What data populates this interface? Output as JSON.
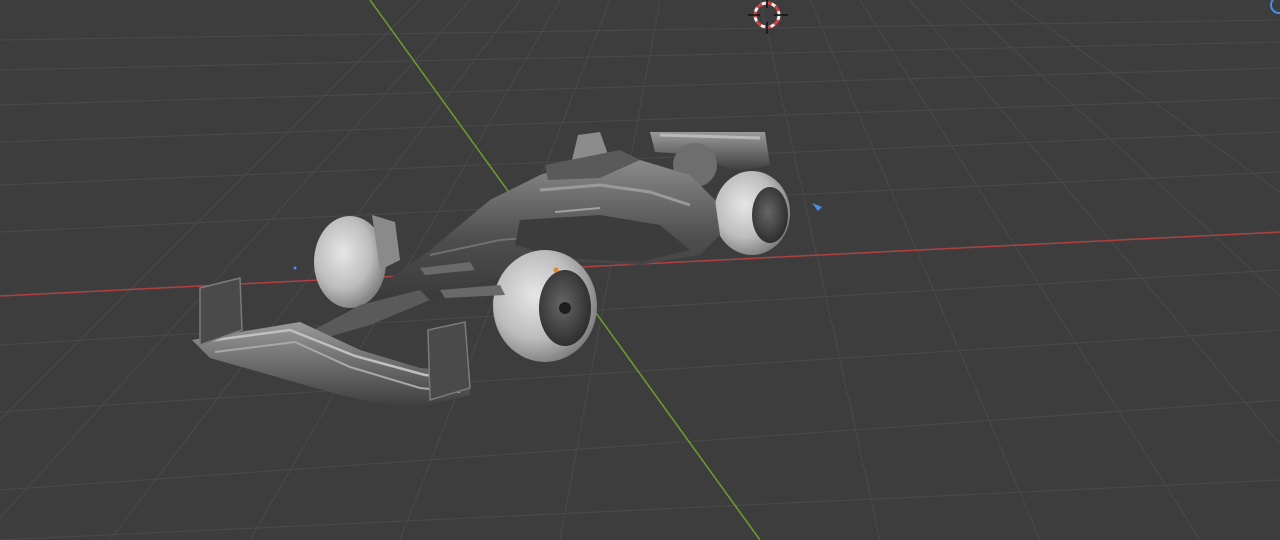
{
  "viewport": {
    "background_color": "#3d3d3d",
    "grid_color": "#4a4a4a",
    "x_axis_color": "#b04040",
    "y_axis_color": "#6d9d30"
  },
  "scene": {
    "object": "formula-one-car-model",
    "cursor_icon": "3d-cursor-icon",
    "light_icon": "light-source-icon",
    "navigation_gizmo_icon": "navigation-gizmo-icon"
  }
}
